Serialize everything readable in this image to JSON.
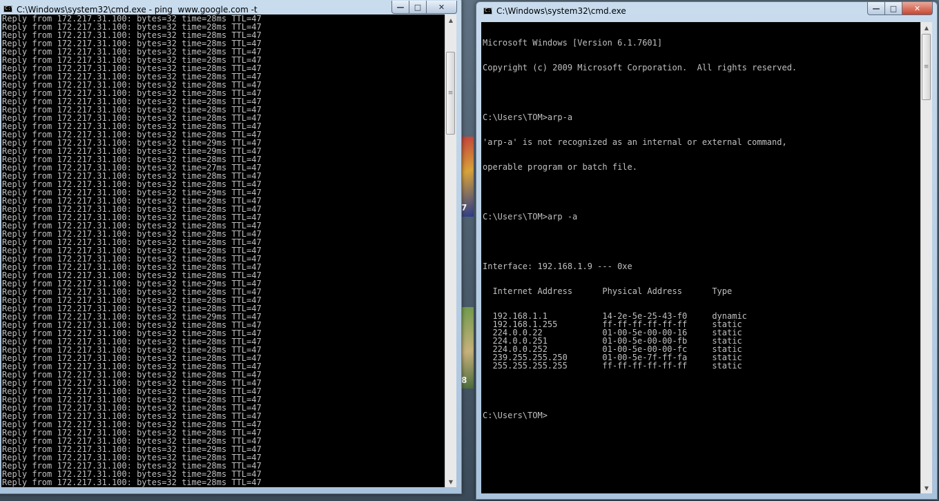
{
  "left_window": {
    "title": "C:\\Windows\\system32\\cmd.exe - ping  www.google.com -t",
    "controls": {
      "minimize": "—",
      "maximize": "□",
      "close": "✕"
    },
    "ping_reply_times": [
      "28ms",
      "28ms",
      "28ms",
      "28ms",
      "28ms",
      "28ms",
      "28ms",
      "28ms",
      "28ms",
      "28ms",
      "28ms",
      "28ms",
      "28ms",
      "28ms",
      "28ms",
      "29ms",
      "29ms",
      "28ms",
      "27ms",
      "28ms",
      "28ms",
      "29ms",
      "28ms",
      "28ms",
      "28ms",
      "28ms",
      "28ms",
      "28ms",
      "28ms",
      "28ms",
      "28ms",
      "28ms",
      "29ms",
      "28ms",
      "28ms",
      "28ms",
      "29ms",
      "28ms",
      "28ms",
      "28ms",
      "28ms",
      "28ms",
      "28ms",
      "28ms",
      "28ms",
      "28ms",
      "28ms",
      "28ms",
      "28ms",
      "28ms",
      "28ms",
      "28ms",
      "29ms",
      "28ms",
      "28ms",
      "28ms",
      "28ms"
    ],
    "reply_prefix": "Reply from 172.217.31.100: bytes=32 time=",
    "reply_suffix": " TTL=47"
  },
  "right_window": {
    "title": "C:\\Windows\\system32\\cmd.exe",
    "controls": {
      "minimize": "—",
      "maximize": "□",
      "close": "✕"
    },
    "header_lines": [
      "Microsoft Windows [Version 6.1.7601]",
      "Copyright (c) 2009 Microsoft Corporation.  All rights reserved."
    ],
    "cmd1": "C:\\Users\\TOM>arp-a",
    "error_lines": [
      "'arp-a' is not recognized as an internal or external command,",
      "operable program or batch file."
    ],
    "cmd2": "C:\\Users\\TOM>arp -a",
    "interface_line": "Interface: 192.168.1.9 --- 0xe",
    "arp_header": "  Internet Address      Physical Address      Type",
    "arp_entries": [
      {
        "ip": "192.168.1.1",
        "mac": "14-2e-5e-25-43-f0",
        "type": "dynamic"
      },
      {
        "ip": "192.168.1.255",
        "mac": "ff-ff-ff-ff-ff-ff",
        "type": "static"
      },
      {
        "ip": "224.0.0.22",
        "mac": "01-00-5e-00-00-16",
        "type": "static"
      },
      {
        "ip": "224.0.0.251",
        "mac": "01-00-5e-00-00-fb",
        "type": "static"
      },
      {
        "ip": "224.0.0.252",
        "mac": "01-00-5e-00-00-fc",
        "type": "static"
      },
      {
        "ip": "239.255.255.250",
        "mac": "01-00-5e-7f-ff-fa",
        "type": "static"
      },
      {
        "ip": "255.255.255.255",
        "mac": "ff-ff-ff-ff-ff-ff",
        "type": "static"
      }
    ],
    "prompt": "C:\\Users\\TOM>"
  },
  "desktop": {
    "tile_numbers": [
      "7",
      "8"
    ]
  },
  "colors": {
    "console_bg": "#000000",
    "console_fg": "#c0c0c0"
  }
}
